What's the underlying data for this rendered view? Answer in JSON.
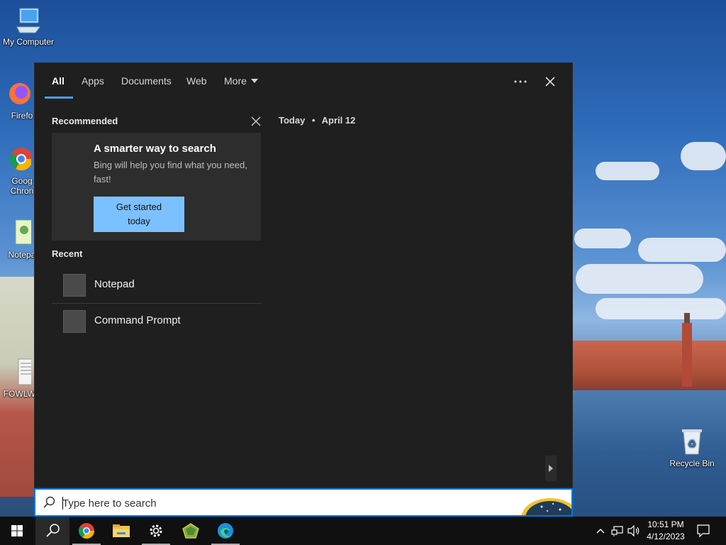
{
  "desktop": {
    "icons": [
      {
        "label": "My Computer"
      },
      {
        "label": "Firefo"
      },
      {
        "label": "Goog\nChron"
      },
      {
        "label": "Notepa"
      },
      {
        "label": "FOWLW/"
      },
      {
        "label": "Recycle Bin"
      }
    ]
  },
  "search_panel": {
    "tabs": [
      {
        "label": "All",
        "active": true
      },
      {
        "label": "Apps"
      },
      {
        "label": "Documents"
      },
      {
        "label": "Web"
      },
      {
        "label": "More"
      }
    ],
    "recommended": {
      "title": "Recommended",
      "card_heading": "A smarter way to search",
      "card_description": "Bing will help you find what you need, fast!",
      "cta_line1": "Get started",
      "cta_line2": "today"
    },
    "recent": {
      "title": "Recent",
      "items": [
        {
          "label": "Notepad"
        },
        {
          "label": "Command Prompt"
        }
      ]
    },
    "today": {
      "label": "Today",
      "separator": "•",
      "date": "April 12"
    }
  },
  "search_box": {
    "placeholder": "Type here to search",
    "value": ""
  },
  "taskbar": {
    "pinned": [
      "start-icon",
      "search-icon",
      "chrome-icon",
      "file-explorer-icon",
      "settings-icon",
      "app-icon",
      "edge-icon"
    ],
    "clock_time": "10:51 PM",
    "clock_date": "4/12/2023"
  },
  "colors": {
    "accent": "#4aa0ea",
    "cta": "#7cc1ff",
    "panel_bg": "#1f1f1f",
    "card_bg": "#2d2d2d",
    "taskbar_bg": "#101010"
  }
}
